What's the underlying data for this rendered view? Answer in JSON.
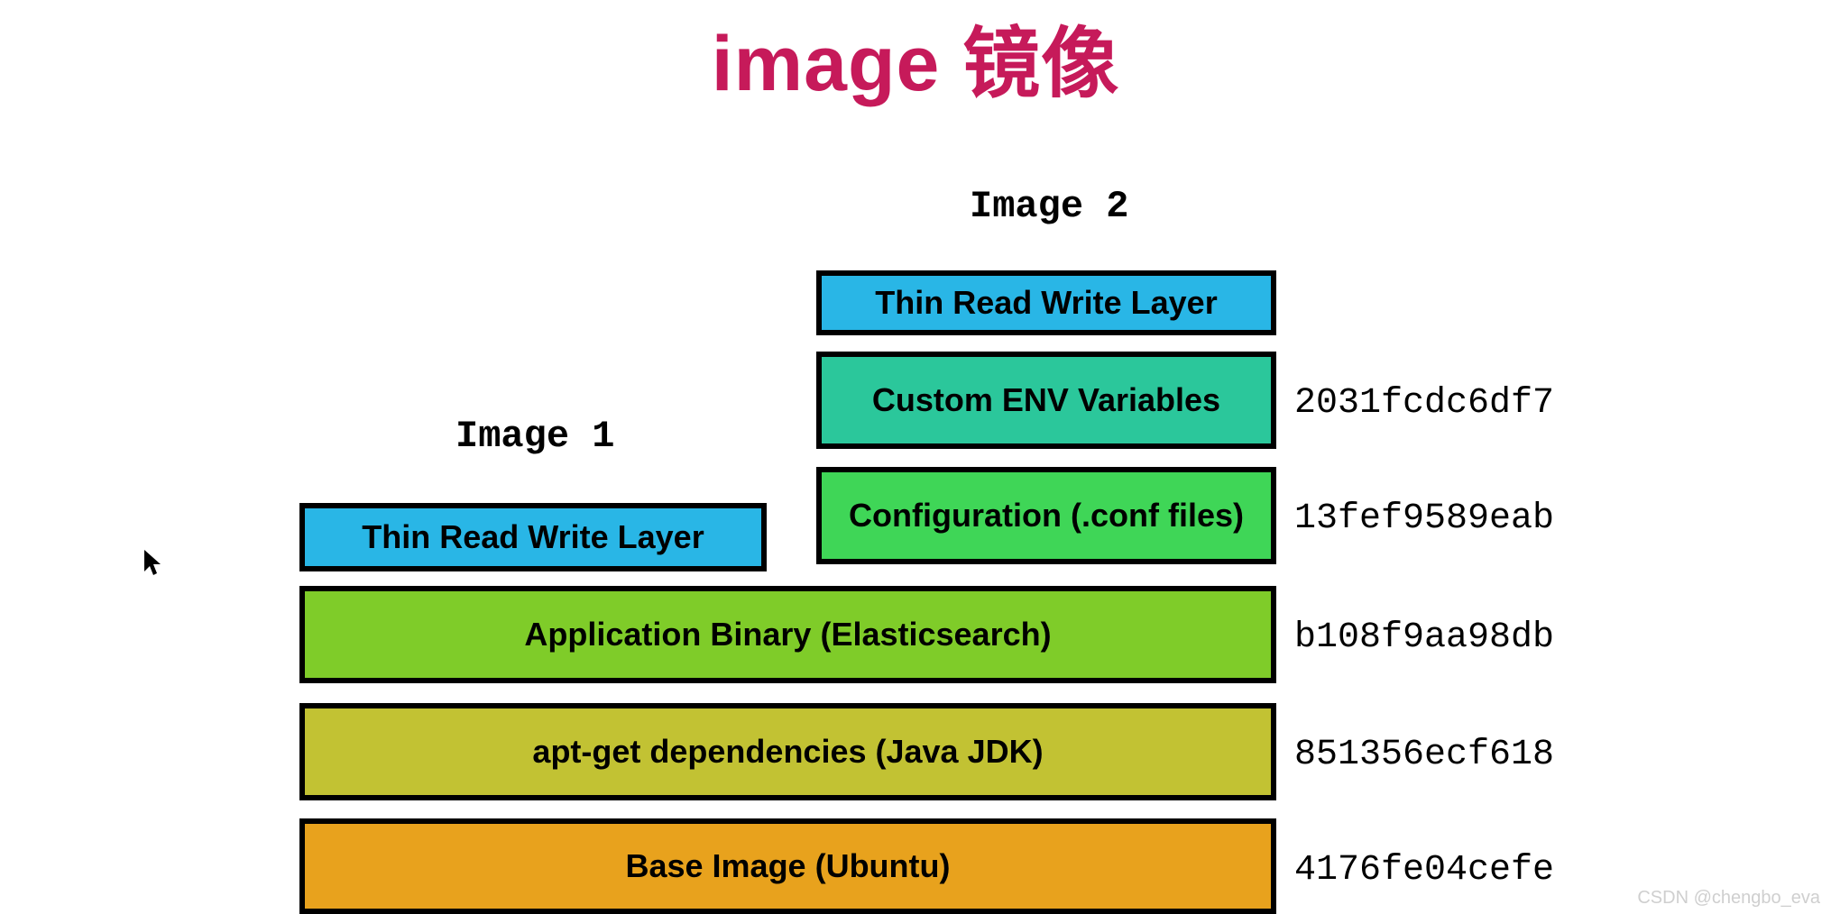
{
  "title": "image 镜像",
  "image1_label": "Image 1",
  "image2_label": "Image 2",
  "boxes": {
    "rw1": {
      "text": "Thin Read Write Layer",
      "color": "#29b6e6"
    },
    "rw2": {
      "text": "Thin Read Write Layer",
      "color": "#29b6e6"
    },
    "env": {
      "text": "Custom ENV Variables",
      "color": "#2bc79b"
    },
    "conf": {
      "text": "Configuration (.conf files)",
      "color": "#3fd657"
    },
    "appbin": {
      "text": "Application Binary (Elasticsearch)",
      "color": "#7fcc29"
    },
    "apt": {
      "text": "apt-get dependencies (Java JDK)",
      "color": "#c2c233"
    },
    "base": {
      "text": "Base Image (Ubuntu)",
      "color": "#e8a21d"
    }
  },
  "hashes": {
    "env": "2031fcdc6df7",
    "conf": "13fef9589eab",
    "appbin": "b108f9aa98db",
    "apt": "851356ecf618",
    "base": "4176fe04cefe"
  },
  "watermark": "CSDN @chengbo_eva",
  "colors": {
    "title": "#c61a5a",
    "border": "#000000"
  }
}
